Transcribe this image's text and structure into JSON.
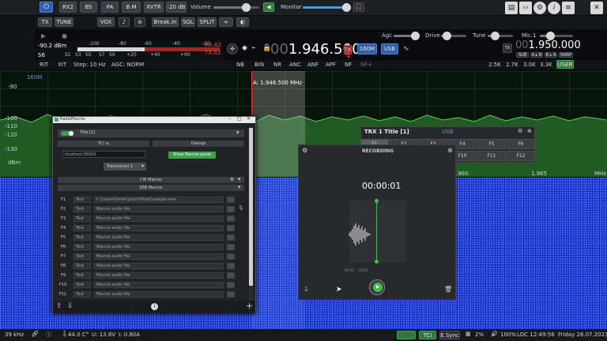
{
  "toolbar": {
    "band_buttons": [
      "RX2",
      "BS",
      "PA",
      "B.M",
      "XVTR"
    ],
    "att_label": "-20 dB",
    "volume_label": "Volume",
    "monitor_label": "Monitor",
    "row2_buttons": [
      "TX",
      "TUNE",
      "VOX"
    ],
    "row2_right": [
      "Break.In",
      "SQL",
      "SPLIT"
    ],
    "right_icons": [
      "layout-icon",
      "code-icon",
      "gear-icon",
      "info-icon",
      "sliders-icon"
    ]
  },
  "controls": {
    "agc_label": "Agc",
    "drive_label": "Drive",
    "tune_label": "Tune",
    "mic_label": "Mic.1"
  },
  "smeter": {
    "scale_top": [
      "-100",
      "-80",
      "-60",
      "-40",
      "-20"
    ],
    "scale_bottom": [
      "S1",
      "S3",
      "S5",
      "S7",
      "S9",
      "+20",
      "+40",
      "+60"
    ],
    "reading_dbm": "-90.2 dBm",
    "reading_s": "S6",
    "rx_label": "RX.A2",
    "tx_label": "TX.A2"
  },
  "vfo_a": {
    "frequency_prefix": "00",
    "frequency_main": "1.946.500",
    "band": "160M",
    "mode": "USB"
  },
  "vfo_b": {
    "frequency_prefix": "00",
    "frequency_main": "1.950.000",
    "tx_badge": "TX",
    "sub_buttons": [
      "SUB",
      "A ▸ B",
      "B ▸ A",
      "SWAP"
    ]
  },
  "status_row": {
    "rit": "RIT",
    "xit": "XIT",
    "step": "Step: 10 Hz",
    "agc": "AGC: NORM",
    "dsp_buttons": [
      "NB",
      "BIN",
      "NR",
      "ANC",
      "ANF",
      "APF",
      "NF",
      "NF+"
    ],
    "filters": [
      "2.5K",
      "2.7K",
      "3.0K",
      "3.3K",
      "USER"
    ]
  },
  "spectrum": {
    "band_label": "160M",
    "cursor_label": "A: 1.946.500 MHz",
    "db_ticks": [
      "-90",
      "-100",
      "-110",
      "-120",
      "-130"
    ],
    "db_unit": "dBm",
    "freq_ticks": [
      ".960",
      "1.965"
    ],
    "freq_unit": "MHz"
  },
  "macros_window": {
    "title": "RadioMacros",
    "toggle_label": "Title [1]",
    "tci_label": "TCI",
    "dialogs_label": "Dialogs",
    "host_value": "localhost:50001",
    "show_panel_button": "Show Macros panel",
    "transceiver_select": "Transceiver 1",
    "cw_section": "CW Macros",
    "ssb_section": "SSB Macros",
    "rows": [
      {
        "key": "F1",
        "text": "Text",
        "file": "C:\\Users\\thelen\\pturn\\Music\\sample.wav"
      },
      {
        "key": "F2",
        "text": "Text",
        "file": "Macros audio file"
      },
      {
        "key": "F3",
        "text": "Text",
        "file": "Macros audio file"
      },
      {
        "key": "F4",
        "text": "Text",
        "file": "Macros audio file"
      },
      {
        "key": "F5",
        "text": "Text",
        "file": "Macros audio file"
      },
      {
        "key": "F6",
        "text": "Text",
        "file": "Macros audio file"
      },
      {
        "key": "F7",
        "text": "Text",
        "file": "Macros audio file"
      },
      {
        "key": "F8",
        "text": "Text",
        "file": "Macros audio file"
      },
      {
        "key": "F9",
        "text": "Text",
        "file": "Macros audio file"
      },
      {
        "key": "F10",
        "text": "Text",
        "file": "Macros audio file"
      },
      {
        "key": "F11",
        "text": "Text",
        "file": "Macros audio file"
      }
    ]
  },
  "trx_panel": {
    "title": "TRX 1 Title [1]",
    "mode": "USB",
    "keys": [
      "F1",
      "F2",
      "F3",
      "F4",
      "F5",
      "F6",
      "F7",
      "F8",
      "F9",
      "F10",
      "F11",
      "F12"
    ]
  },
  "recording": {
    "title": "RECORDING",
    "timer": "00:00:01",
    "time_marks": [
      "00:00",
      "00:01"
    ]
  },
  "statusbar": {
    "span": "39 kHz",
    "temp": "44.0 C°",
    "voltage": "U: 13.8V",
    "current": "I: 0.80A",
    "tci": "TCI",
    "esync": "E.Sync",
    "cpu": "2%",
    "volume": "100%",
    "loc_time": "LOC 12:49:56",
    "date": "Friday 28.07.2023"
  },
  "colors": {
    "accent_blue": "#4a9bd8",
    "green": "#2d7b3a",
    "red": "#a52424",
    "waterfall": "#1530c8",
    "spectrum": "#4fc04a"
  }
}
